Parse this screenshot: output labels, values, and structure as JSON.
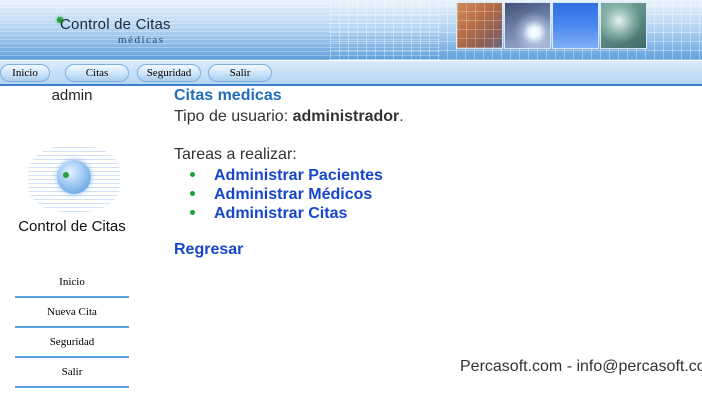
{
  "header": {
    "logo_title": "Control de Citas",
    "logo_subtitle": "médicas",
    "thumb_icons": [
      "grid-pattern-thumbnail",
      "lightning-sky-thumbnail",
      "blue-sky-thumbnail",
      "clouds-thumbnail"
    ]
  },
  "topnav": {
    "items": [
      {
        "label": "Inicio"
      },
      {
        "label": "Citas"
      },
      {
        "label": "Seguridad"
      },
      {
        "label": "Salir"
      }
    ]
  },
  "sidebar": {
    "username": "admin",
    "app_title": "Control de Citas",
    "menu": [
      {
        "label": "Inicio"
      },
      {
        "label": "Nueva Cita"
      },
      {
        "label": "Seguridad"
      },
      {
        "label": "Salir"
      }
    ]
  },
  "main": {
    "title": "Citas medicas",
    "user_type_label": "Tipo de usuario: ",
    "user_type_value": "administrador",
    "user_type_suffix": ".",
    "tasks_label": "Tareas a realizar:",
    "tasks": [
      {
        "label": "Administrar Pacientes"
      },
      {
        "label": "Administrar Médicos"
      },
      {
        "label": "Administrar Citas"
      }
    ],
    "back_label": "Regresar"
  },
  "footer": {
    "text": "Percasoft.com - info@percasoft.com"
  },
  "colors": {
    "title_blue": "#1f6eb8",
    "link_blue": "#1646cc",
    "bullet_green": "#15a23a",
    "nav_border": "#3e80c8"
  }
}
